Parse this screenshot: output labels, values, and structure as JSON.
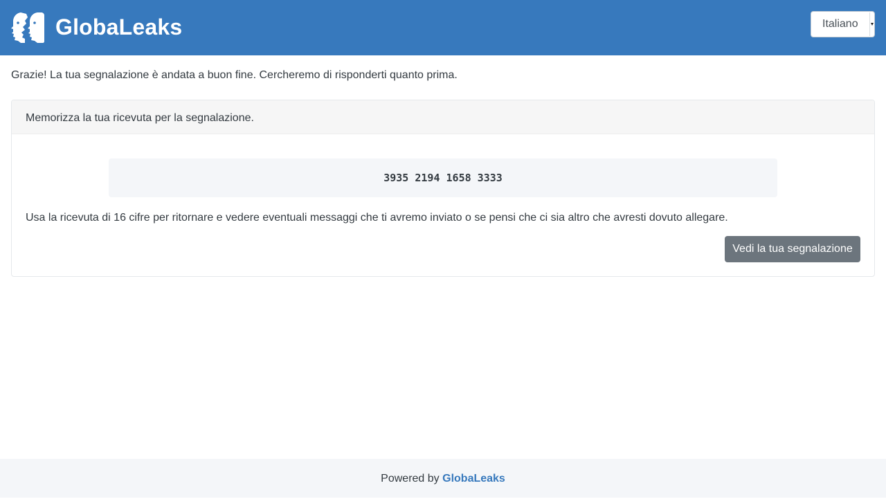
{
  "header": {
    "app_title": "GlobaLeaks",
    "logo_icon": "globaleaks-logo-icon",
    "language": {
      "selected": "Italiano"
    },
    "colors": {
      "brand": "#3779bd"
    }
  },
  "main": {
    "success_message": "Grazie! La tua segnalazione è andata a buon fine. Cercheremo di risponderti quanto prima.",
    "receipt_card": {
      "title": "Memorizza la tua ricevuta per la segnalazione.",
      "receipt_code": "3935 2194 1658 3333",
      "help_text": "Usa la ricevuta di 16 cifre per ritornare e vedere eventuali messaggi che ti avremo inviato o se pensi che ci sia altro che avresti dovuto allegare.",
      "view_button_label": "Vedi la tua segnalazione",
      "button_color": "#6c757d"
    }
  },
  "footer": {
    "powered_by": "Powered by",
    "link_text": "GlobaLeaks"
  }
}
